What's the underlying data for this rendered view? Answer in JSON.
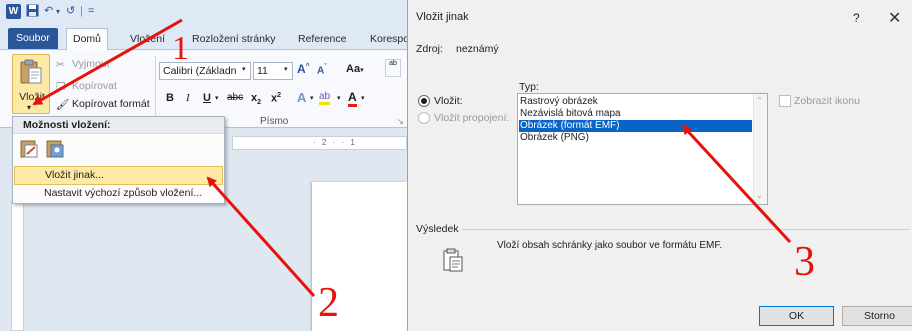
{
  "word": {
    "logo": "W",
    "qat": {
      "undo": "↶",
      "dropdown": "▾",
      "redo": "↺",
      "separator": "|",
      "customize": "="
    },
    "tabs": [
      {
        "label": "Soubor"
      },
      {
        "label": "Domů"
      },
      {
        "label": "Vložení"
      },
      {
        "label": "Rozložení stránky"
      },
      {
        "label": "Reference"
      },
      {
        "label": "Korespo"
      }
    ],
    "clipboard": {
      "paste_label": "Vložit",
      "cut_label": "Vyjmout",
      "copy_label": "Kopírovat",
      "format_painter_label": "Kopírovat formát"
    },
    "font": {
      "name": "Calibri (Základn",
      "size": "11",
      "group_label": "Písmo"
    },
    "ruler_text": "· 2 · · 1",
    "paste_menu": {
      "header": "Možnosti vložení:",
      "item_paste_special": "Vložit jinak...",
      "item_set_default": "Nastavit výchozí způsob vložení..."
    }
  },
  "dialog": {
    "title": "Vložit jinak",
    "help": "?",
    "close": "✕",
    "source_label": "Zdroj:",
    "source_value": "neznámý",
    "type_label": "Typ:",
    "paste_radio_label": "Vložit:",
    "paste_link_radio_label": "Vložit propojení:",
    "types": [
      "Rastrový obrázek",
      "Nezávislá bitová mapa",
      "Obrázek (formát EMF)",
      "Obrázek (PNG)"
    ],
    "selected_type_index": 2,
    "display_icon_label": "Zobrazit ikonu",
    "result_label": "Výsledek",
    "result_text": "Vloží obsah schránky jako soubor ve formátu EMF.",
    "ok_label": "OK",
    "cancel_label": "Storno"
  },
  "annotations": {
    "step1": "1",
    "step2": "2",
    "step3": "3",
    "color": "#e8120c"
  },
  "colors": {
    "word_blue": "#2b579a",
    "highlight": "#fde9a6",
    "selection": "#0a64c8"
  }
}
